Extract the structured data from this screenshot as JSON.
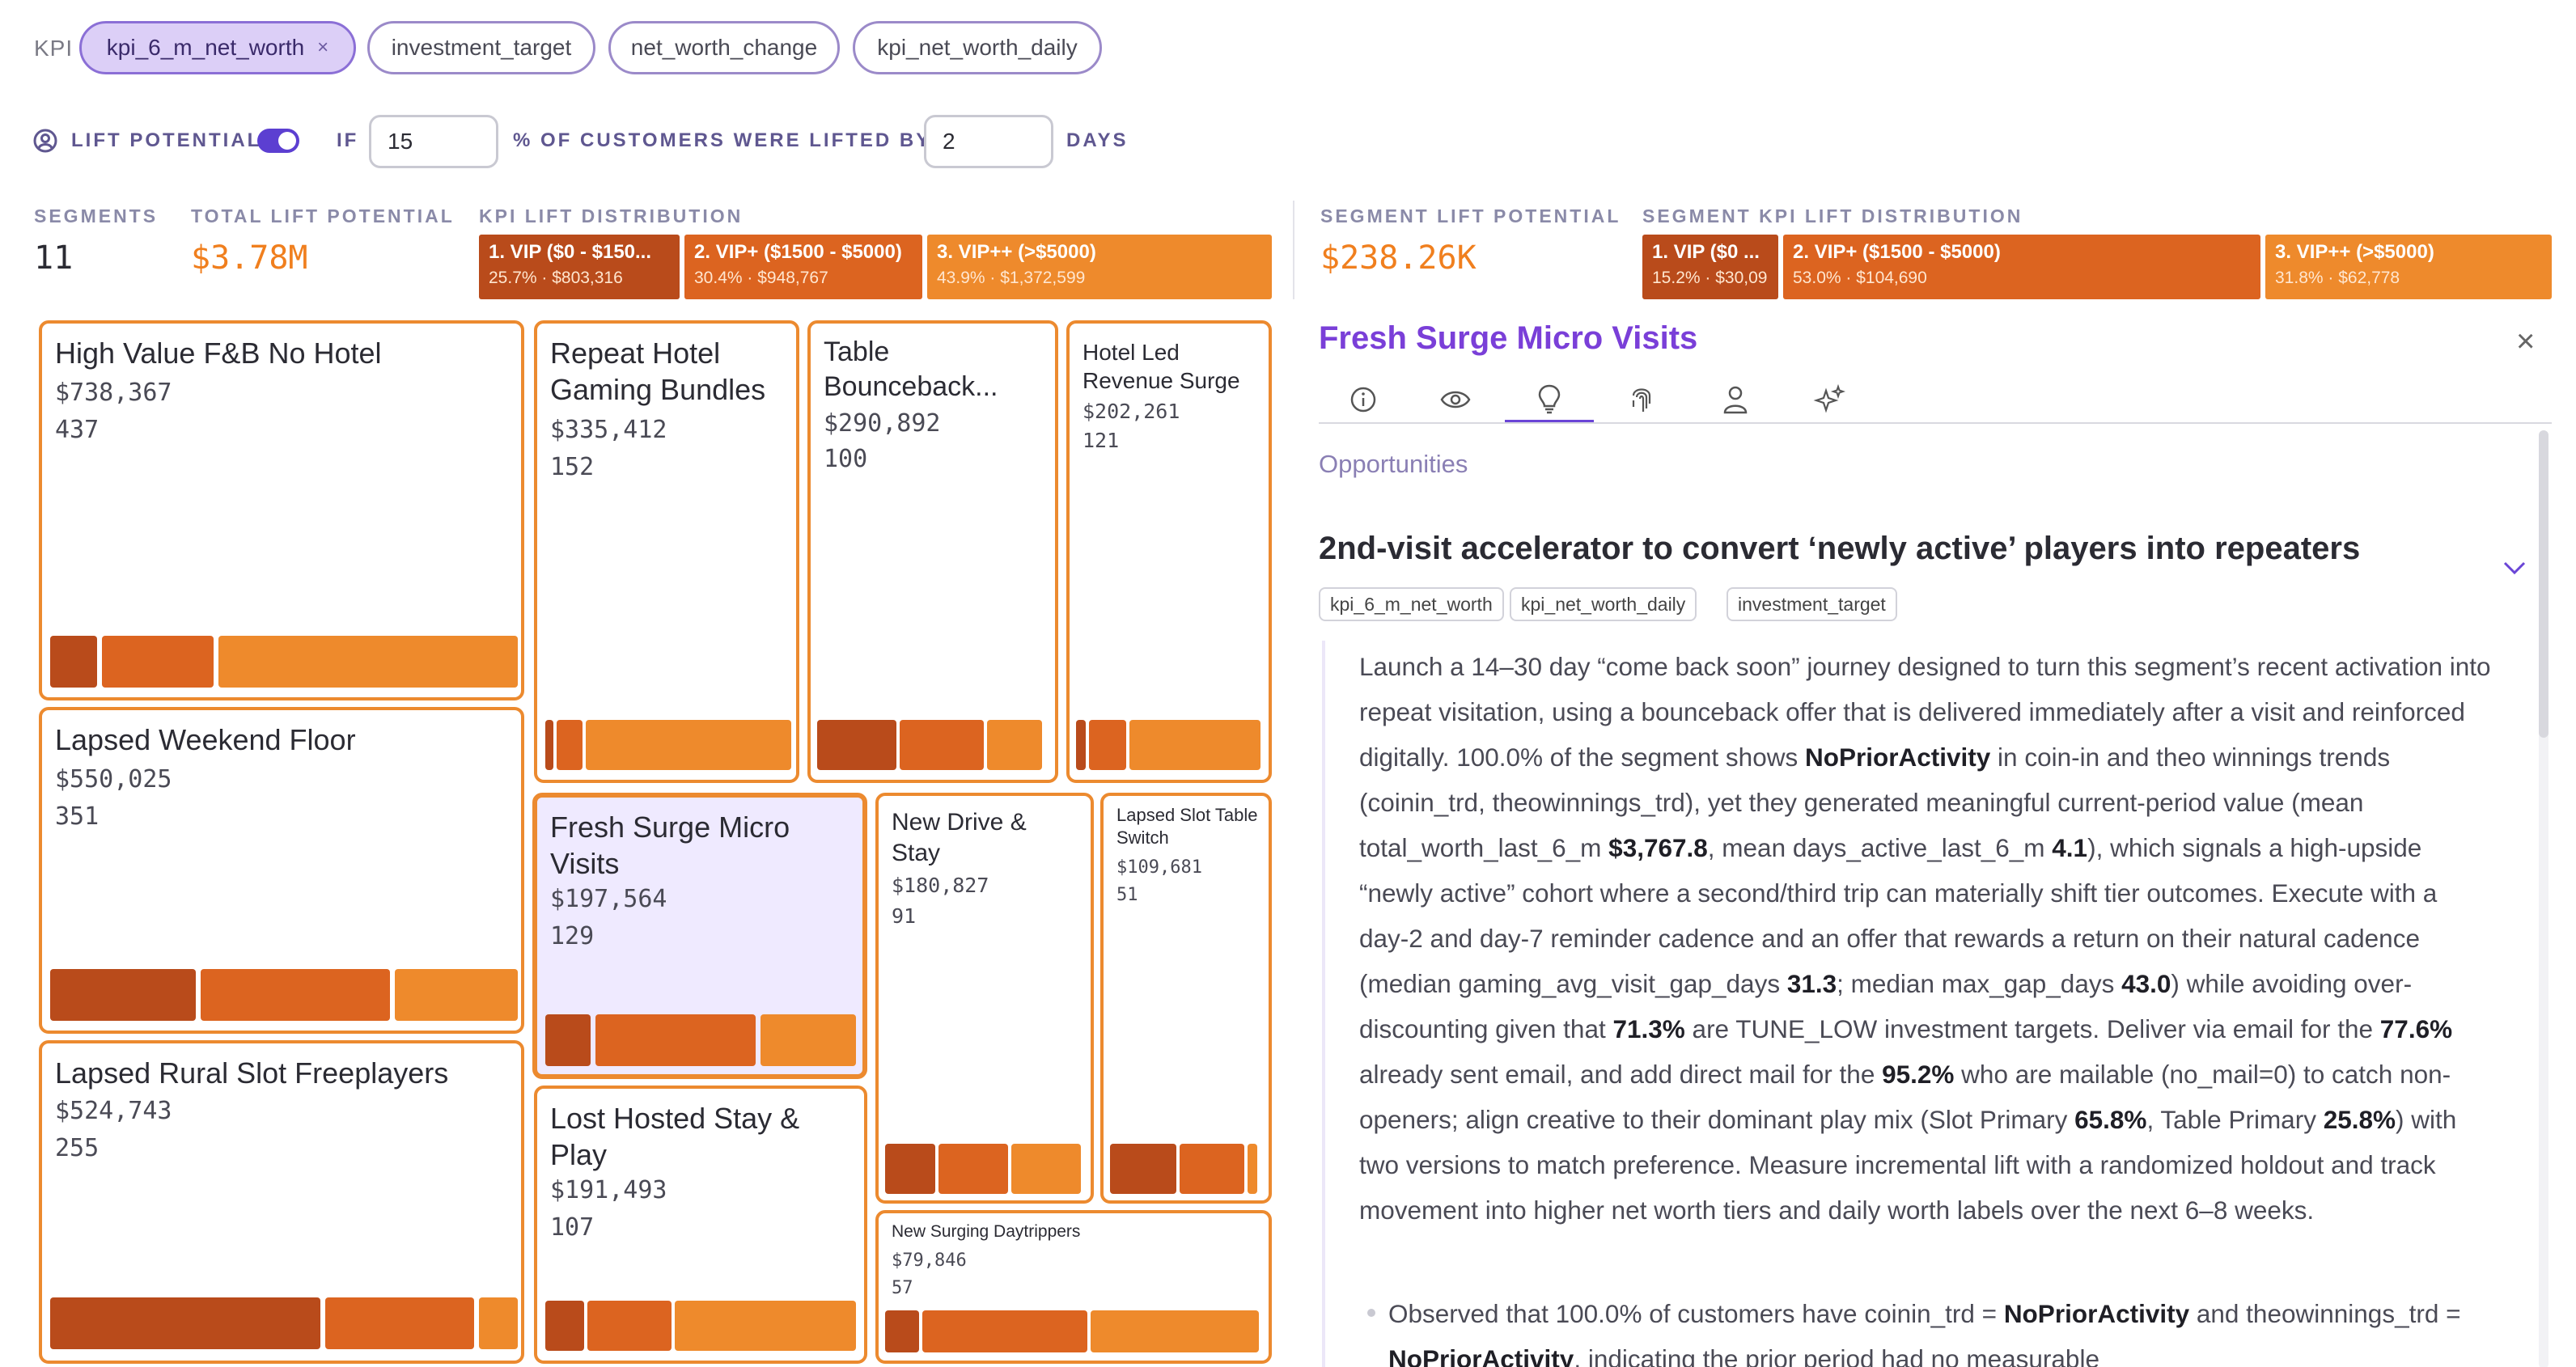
{
  "kpi": {
    "label": "KPI",
    "chips": [
      {
        "label": "kpi_6_m_net_worth",
        "close": "×"
      },
      {
        "label": "investment_target"
      },
      {
        "label": "net_worth_change"
      },
      {
        "label": "kpi_net_worth_daily"
      }
    ]
  },
  "lift": {
    "label": "LIFT POTENTIAL",
    "if_label": "IF",
    "percent_value": "15",
    "middle_label": "% OF CUSTOMERS WERE LIFTED BY",
    "days_value": "2",
    "days_label": "DAYS",
    "toggle_on": true
  },
  "stats": {
    "segments_label": "SEGMENTS",
    "segments_value": "11",
    "total_label": "TOTAL LIFT POTENTIAL",
    "total_value": "$3.78M",
    "dist_label": "KPI LIFT DISTRIBUTION",
    "dist": [
      {
        "title": "1. VIP ($0 - $150...",
        "sub": "25.7% · $803,316"
      },
      {
        "title": "2. VIP+ ($1500 - $5000)",
        "sub": "30.4% · $948,767"
      },
      {
        "title": "3. VIP++ (>$5000)",
        "sub": "43.9% · $1,372,599"
      }
    ],
    "seg_lift_label": "SEGMENT LIFT POTENTIAL",
    "seg_lift_value": "$238.26K",
    "seg_dist_label": "SEGMENT KPI LIFT DISTRIBUTION",
    "seg_dist": [
      {
        "title": "1. VIP ($0 ...",
        "sub": "15.2% · $30,09"
      },
      {
        "title": "2. VIP+ ($1500 - $5000)",
        "sub": "53.0% · $104,690"
      },
      {
        "title": "3. VIP++ (>$5000)",
        "sub": "31.8% · $62,778"
      }
    ]
  },
  "colors": {
    "tier1": "#b94b1b",
    "tier2": "#dc6420",
    "tier3": "#ee8a2c",
    "accent": "#6a45d6",
    "total": "#f07f1e"
  },
  "segments": [
    {
      "name": "High Value F&B No Hotel",
      "value": "$738,367",
      "count": "437"
    },
    {
      "name": "Repeat Hotel Gaming Bundles",
      "value": "$335,412",
      "count": "152"
    },
    {
      "name": "Table Bounceback...",
      "value": "$290,892",
      "count": "100"
    },
    {
      "name": "Hotel Led Revenue Surge",
      "value": "$202,261",
      "count": "121"
    },
    {
      "name": "Lapsed Weekend Floor",
      "value": "$550,025",
      "count": "351"
    },
    {
      "name": "Fresh Surge Micro Visits",
      "value": "$197,564",
      "count": "129"
    },
    {
      "name": "New Drive & Stay",
      "value": "$180,827",
      "count": "91"
    },
    {
      "name": "Lapsed Slot Table Switch",
      "value": "$109,681",
      "count": "51"
    },
    {
      "name": "Lapsed Rural Slot Freeplayers",
      "value": "$524,743",
      "count": "255"
    },
    {
      "name": "Lost Hosted Stay & Play",
      "value": "$191,493",
      "count": "107"
    },
    {
      "name": "New Surging Daytrippers",
      "value": "$79,846",
      "count": "57"
    }
  ],
  "panel": {
    "title": "Fresh Surge Micro Visits",
    "close": "×",
    "tabs": [
      "info-icon",
      "eye-icon",
      "lightbulb-icon",
      "fingerprint-icon",
      "person-icon",
      "sparkles-icon"
    ],
    "section": "Opportunities",
    "heading": "2nd-visit accelerator to convert ‘newly active’ players into repeaters",
    "tags": [
      "kpi_6_m_net_worth",
      "kpi_net_worth_daily",
      "investment_target"
    ],
    "p": {
      "a": "Launch a 14–30 day “come back soon” journey designed to turn this segment’s recent activation into repeat visitation, using a bounceback offer that is delivered immediately after a visit and reinforced digitally. 100.0% of the segment shows ",
      "b1": "NoPriorActivity",
      "c": " in coin-in and theo winnings trends (coinin_trd, theowinnings_trd), yet they generated meaningful current-period value (mean total_worth_last_6_m ",
      "b2": "$3,767.8",
      "d": ", mean days_active_last_6_m ",
      "b3": "4.1",
      "e": "), which signals a high-upside “newly active” cohort where a second/third trip can materially shift tier outcomes. Execute with a day-2 and day-7 reminder cadence and an offer that rewards a return on their natural cadence (median gaming_avg_visit_gap_days ",
      "b4": "31.3",
      "f": "; median max_gap_days ",
      "b5": "43.0",
      "g": ") while avoiding over-discounting given that ",
      "b6": "71.3%",
      "h": " are TUNE_LOW investment targets. Deliver via email for the ",
      "b7": "77.6%",
      "i": " already sent email, and add direct mail for the ",
      "b8": "95.2%",
      "j": " who are mailable (no_mail=0) to catch non-openers; align creative to their dominant play mix (Slot Primary ",
      "b9": "65.8%",
      "k": ", Table Primary ",
      "b10": "25.8%",
      "l": ") with two versions to match preference. Measure incremental lift with a randomized holdout and track movement into higher net worth tiers and daily worth labels over the next 6–8 weeks."
    },
    "bullet": {
      "a": "Observed that 100.0% of customers have coinin_trd = ",
      "b1": "NoPriorActivity",
      "c": " and theowinnings_trd = ",
      "b2": "NoPriorActivity",
      "d": ", indicating the prior period had no measurable"
    }
  }
}
